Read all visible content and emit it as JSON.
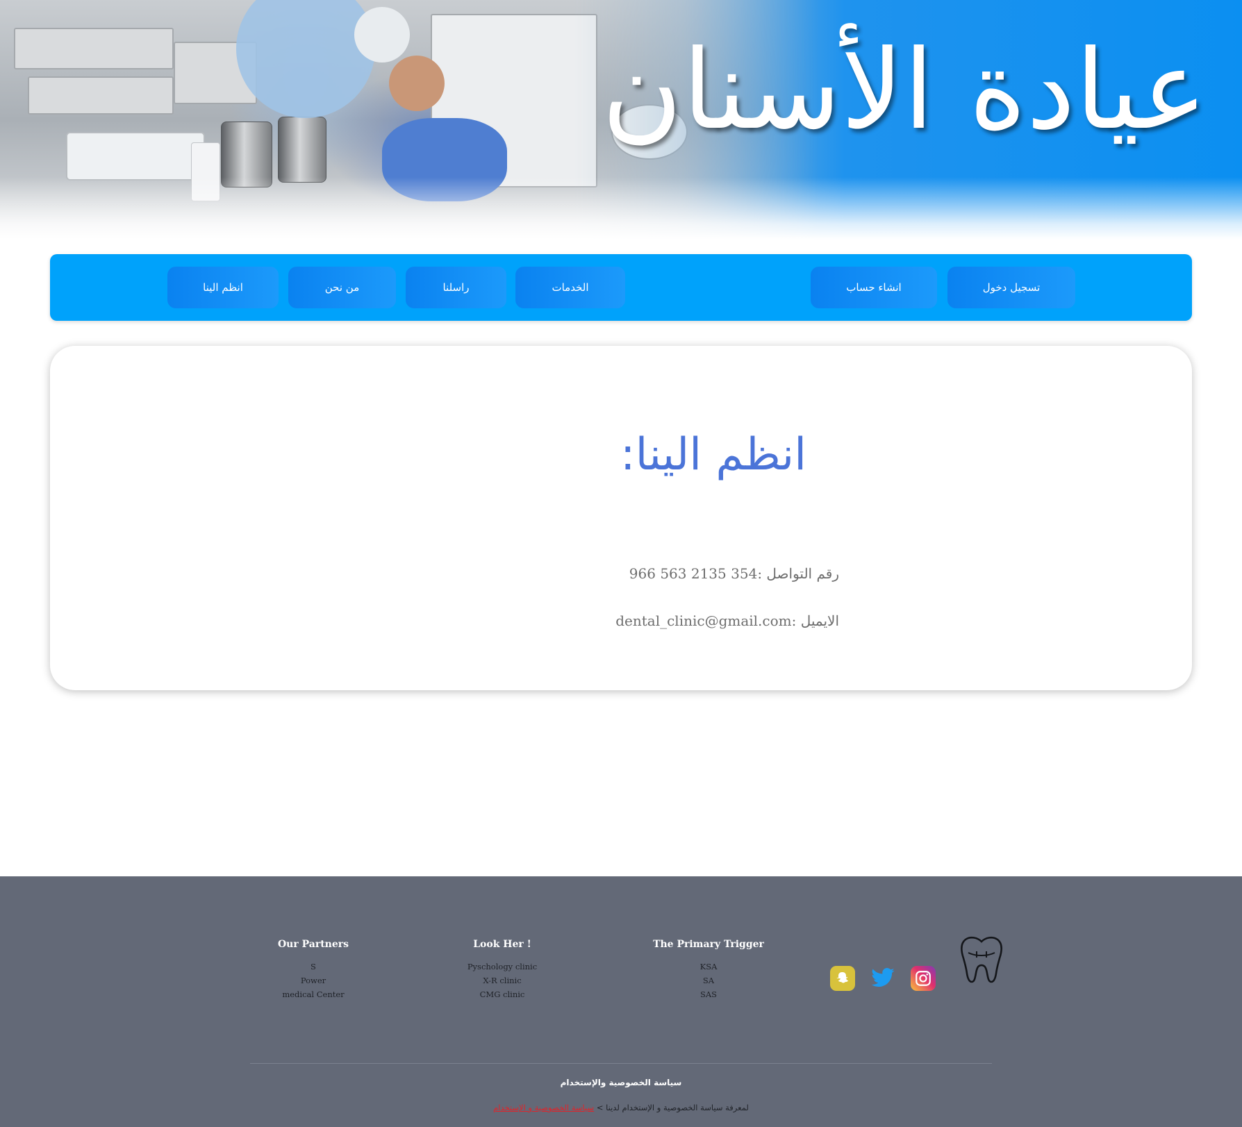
{
  "header": {
    "title": "عيادة الأسنان"
  },
  "nav": {
    "login": "تسجيل دخول",
    "signup": "انشاء حساب",
    "services": "الخدمات",
    "contact": "راسلنا",
    "about": "من نحن",
    "join": "انظم الينا"
  },
  "main": {
    "heading": "انظم الينا:",
    "phone": "رقم التواصل :354 2135 563 966",
    "email": "الايميل :dental_clinic@gmail.com"
  },
  "footer": {
    "columns": [
      {
        "title": "Our Partners",
        "items": [
          "S",
          "Power",
          "medical Center"
        ]
      },
      {
        "title": "Look Her !",
        "items": [
          "Pyschology clinic",
          "X-R clinic",
          "CMG clinic"
        ]
      },
      {
        "title": "The Primary Trigger",
        "items": [
          "KSA",
          "SA",
          "SAS"
        ]
      }
    ],
    "social": [
      {
        "icon": "snapchat-icon",
        "color": "#d8c23c"
      },
      {
        "icon": "twitter-icon",
        "color": "#1d9bf0"
      },
      {
        "icon": "instagram-icon",
        "color": "#c13584"
      }
    ],
    "logo_icon": "tooth-icon",
    "policy_title": "سياسة الخصوصية والإستخدام",
    "policy_text": "لمعرفة سياسة الخصوصية و الإستخدام لدينا >",
    "policy_link": "سياسة الخصوصية و الإستخدام"
  },
  "colors": {
    "nav_bg": "#00a2fb",
    "heading": "#4b74d8",
    "footer_bg": "#636977",
    "link": "#e0242a"
  }
}
